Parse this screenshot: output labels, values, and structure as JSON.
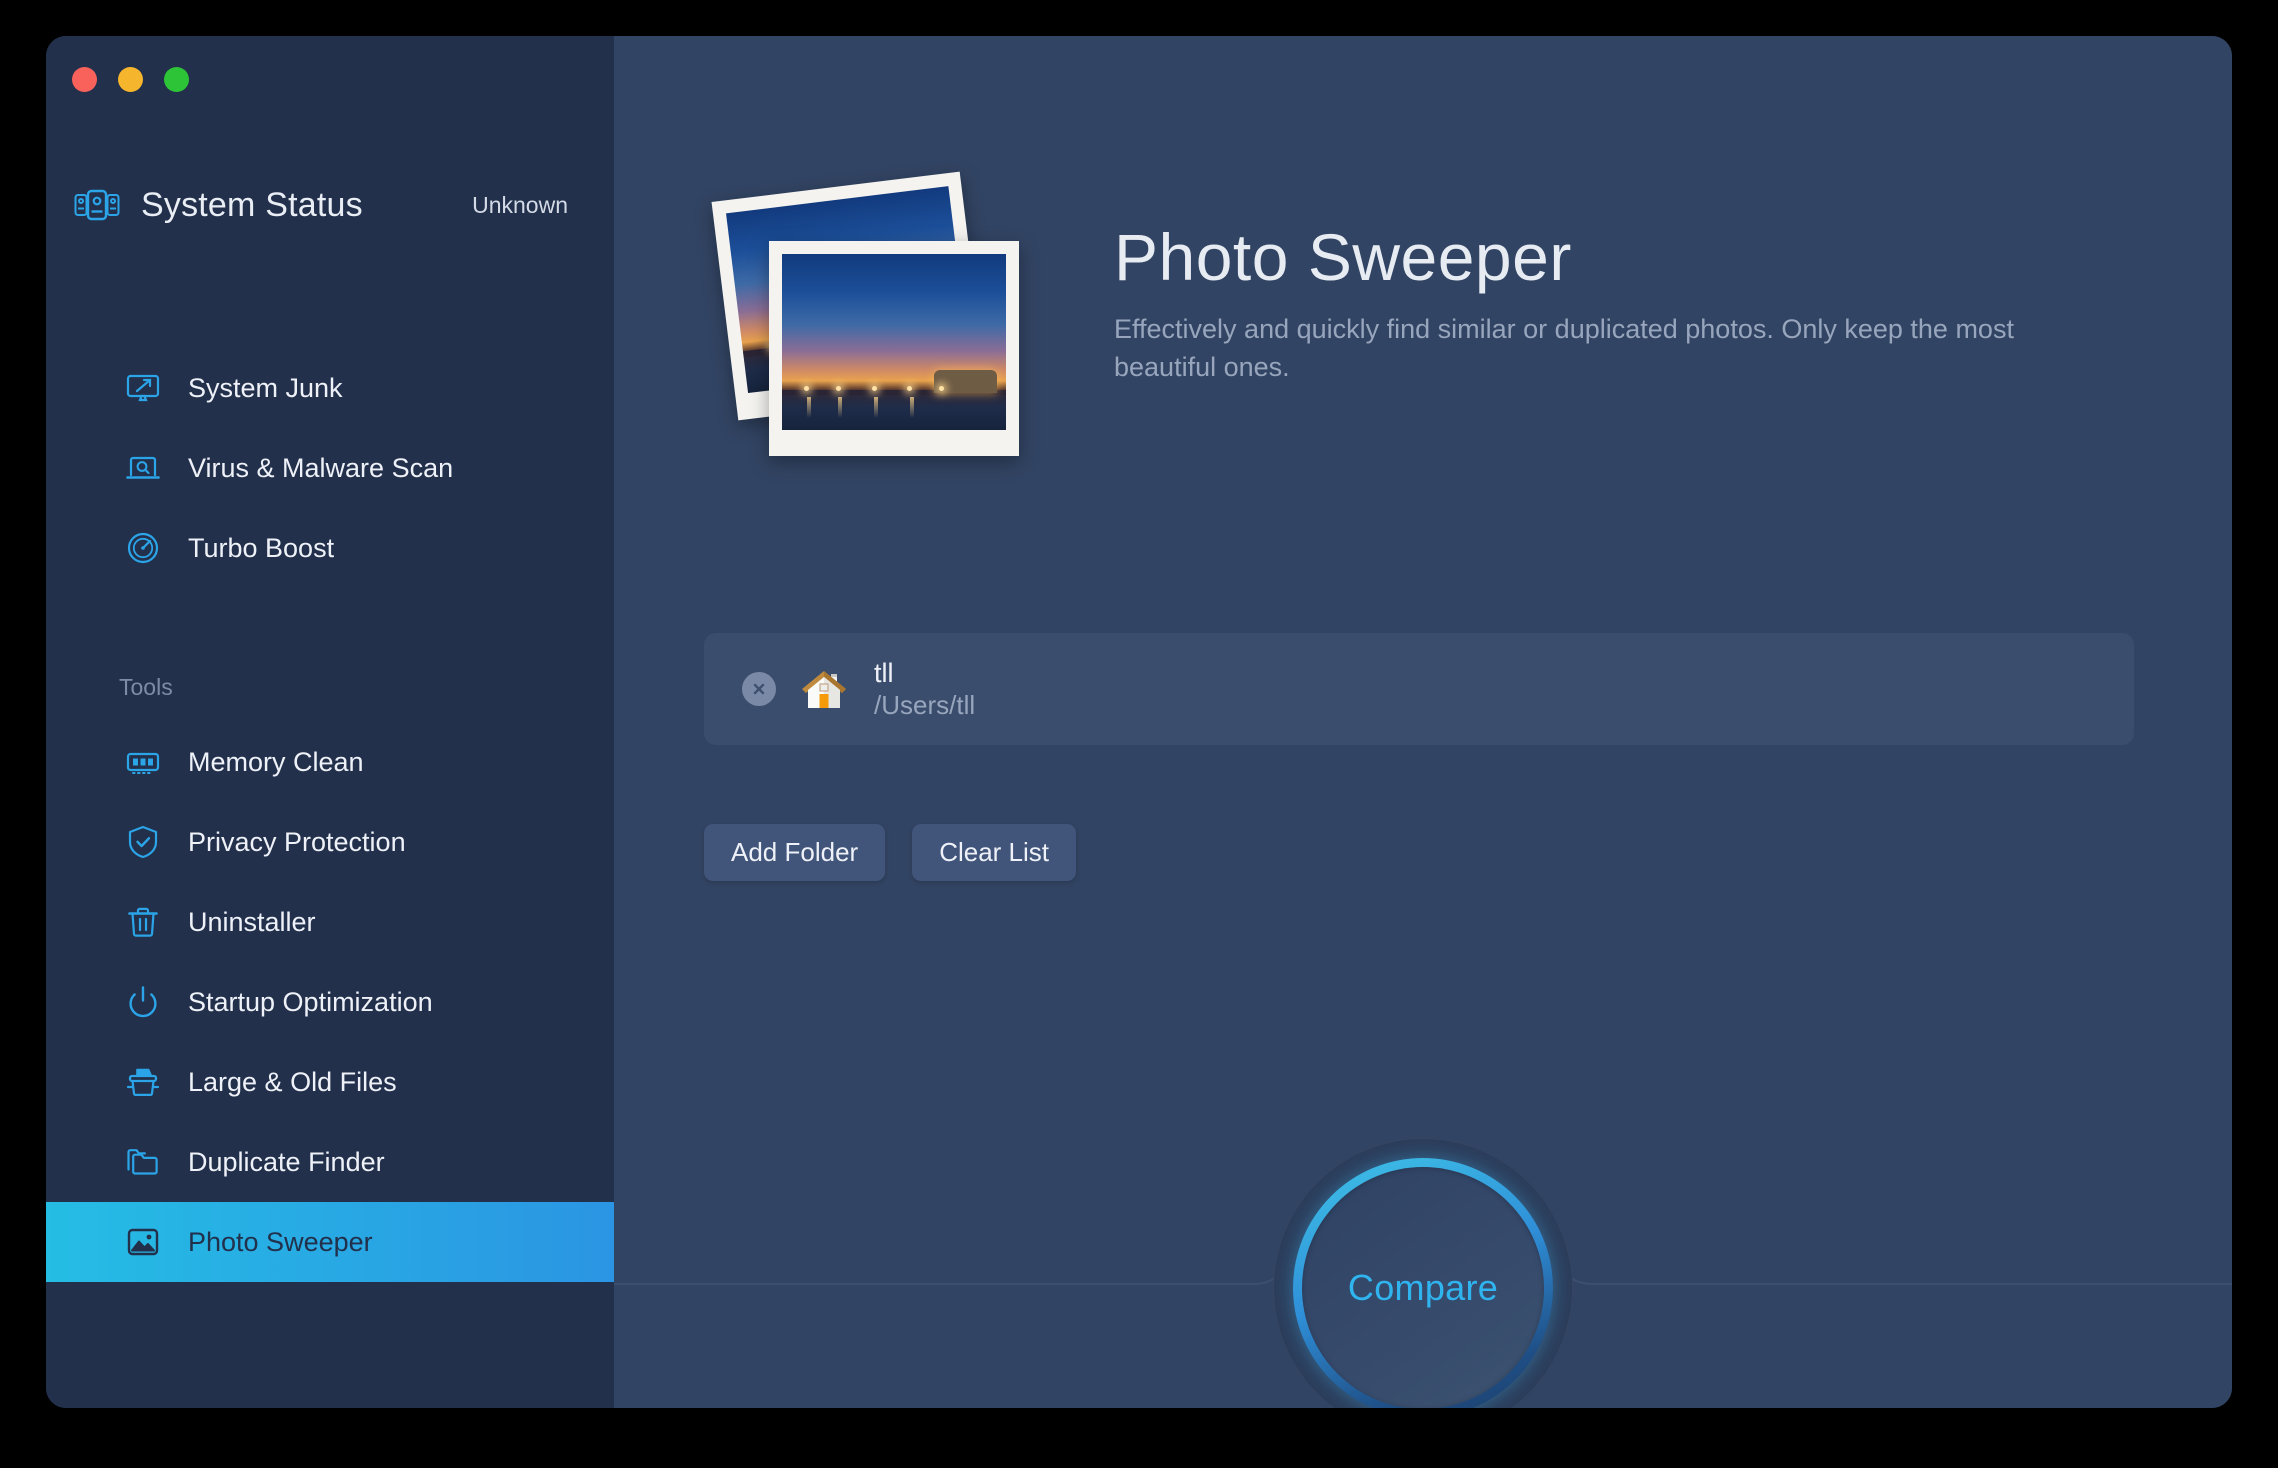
{
  "window": {
    "traffic_lights": [
      {
        "name": "close",
        "color": "#f9615b"
      },
      {
        "name": "minimize",
        "color": "#f5b52c"
      },
      {
        "name": "maximize",
        "color": "#2ec437"
      }
    ]
  },
  "sidebar": {
    "system_status": {
      "icon": "system-status-icon",
      "title": "System Status",
      "value": "Unknown"
    },
    "primary_items": [
      {
        "icon": "monitor-arrow-icon",
        "label": "System Junk"
      },
      {
        "icon": "laptop-search-icon",
        "label": "Virus & Malware Scan"
      },
      {
        "icon": "speedometer-icon",
        "label": "Turbo Boost"
      }
    ],
    "tools_label": "Tools",
    "tool_items": [
      {
        "icon": "memory-chip-icon",
        "label": "Memory Clean",
        "active": false
      },
      {
        "icon": "shield-check-icon",
        "label": "Privacy Protection",
        "active": false
      },
      {
        "icon": "trash-icon",
        "label": "Uninstaller",
        "active": false
      },
      {
        "icon": "power-icon",
        "label": "Startup Optimization",
        "active": false
      },
      {
        "icon": "file-box-icon",
        "label": "Large & Old Files",
        "active": false
      },
      {
        "icon": "duplicate-folder-icon",
        "label": "Duplicate Finder",
        "active": false
      },
      {
        "icon": "picture-icon",
        "label": "Photo Sweeper",
        "active": true
      }
    ],
    "colors": {
      "background": "#22304b",
      "icon_accent": "#2ba4e8",
      "active_gradient_start": "#25bde4",
      "active_gradient_end": "#2b95e3"
    }
  },
  "main": {
    "hero": {
      "artwork": "stacked-photos-icon",
      "title": "Photo Sweeper",
      "subtitle": "Effectively and quickly find similar or duplicated photos. Only keep the most beautiful ones."
    },
    "folders": [
      {
        "remove_icon": "close-circle-icon",
        "folder_icon": "home-folder-icon",
        "name": "tll",
        "path": "/Users/tll"
      }
    ],
    "actions": [
      {
        "name": "add-folder-button",
        "label": "Add Folder"
      },
      {
        "name": "clear-list-button",
        "label": "Clear List"
      }
    ],
    "compare": {
      "label": "Compare",
      "accent": "#2fb4f0"
    },
    "colors": {
      "background": "#324463",
      "row_background": "#3a4d6d",
      "button_background": "#41557a"
    }
  }
}
